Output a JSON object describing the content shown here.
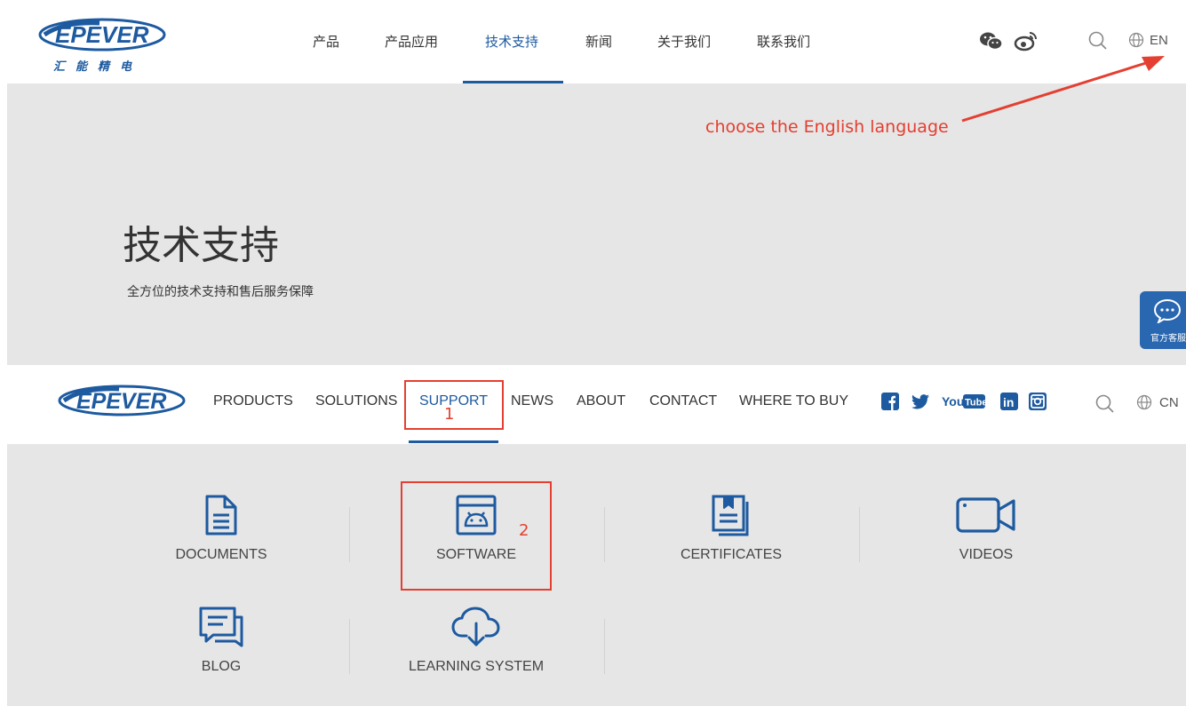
{
  "colors": {
    "brand": "#1d5aa0",
    "annotation": "#e43f30",
    "banner_bg": "#e6e6e6",
    "chat": "#2a67b1"
  },
  "cn_header": {
    "logo_text": "EPEVER",
    "logo_cn": "汇能精电",
    "nav": [
      "产品",
      "产品应用",
      "技术支持",
      "新闻",
      "关于我们",
      "联系我们"
    ],
    "active_nav": "技术支持",
    "social_icons": [
      "wechat-icon",
      "weibo-icon"
    ],
    "lang": "EN"
  },
  "annotation": {
    "text": "choose the English language",
    "step1": "1",
    "step2": "2"
  },
  "banner": {
    "title": "技术支持",
    "subtitle": "全方位的技术支持和售后服务保障",
    "chat_label": "官方客服"
  },
  "en_header": {
    "logo_text": "EPEVER",
    "nav": [
      "PRODUCTS",
      "SOLUTIONS",
      "SUPPORT",
      "NEWS",
      "ABOUT",
      "CONTACT",
      "WHERE TO BUY"
    ],
    "active_nav": "SUPPORT",
    "social_icons": [
      "facebook-icon",
      "twitter-icon",
      "youtube-icon",
      "linkedin-icon",
      "instagram-icon"
    ],
    "youtube_text": {
      "you": "You",
      "tube": "Tube"
    },
    "linkedin_text": "in",
    "lang": "CN"
  },
  "support_tiles": [
    {
      "label": "DOCUMENTS",
      "icon": "document-icon"
    },
    {
      "label": "SOFTWARE",
      "icon": "software-icon"
    },
    {
      "label": "CERTIFICATES",
      "icon": "certificate-icon"
    },
    {
      "label": "VIDEOS",
      "icon": "video-icon"
    },
    {
      "label": "BLOG",
      "icon": "blog-icon"
    },
    {
      "label": "LEARNING SYSTEM",
      "icon": "cloud-download-icon"
    }
  ]
}
